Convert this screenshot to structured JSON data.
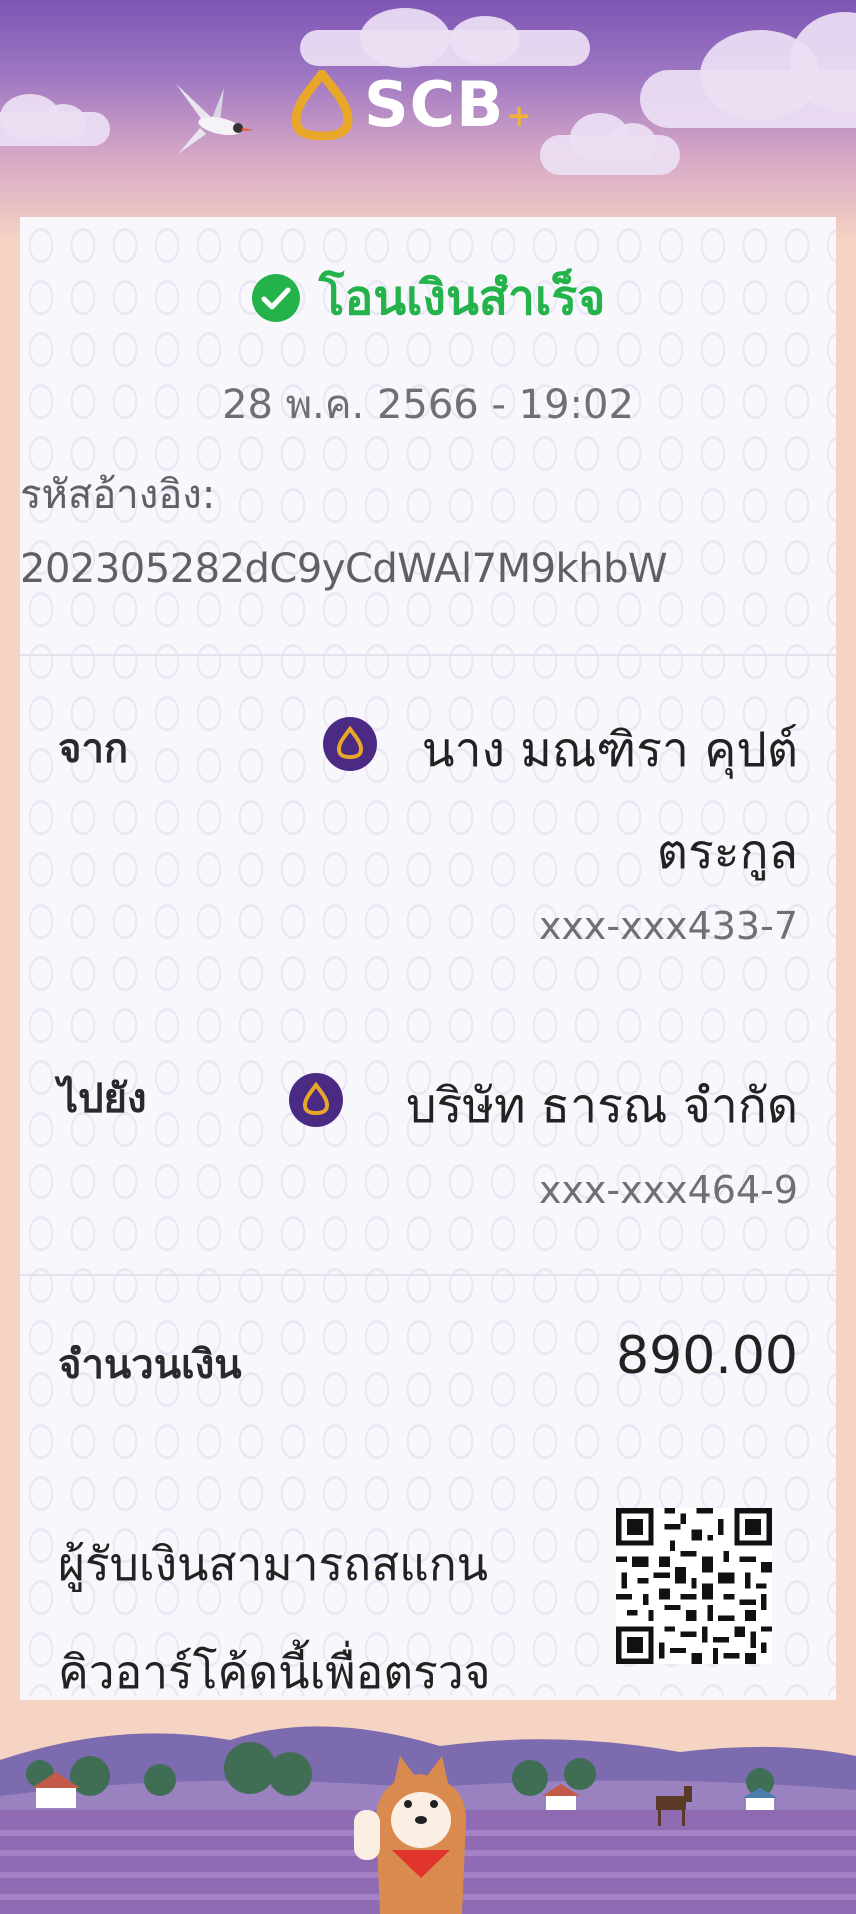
{
  "header": {
    "brand_text": "SCB",
    "brand_plus": "+",
    "accent_color": "#7e55b4",
    "gold_color": "#e9a72a"
  },
  "receipt": {
    "status_text": "โอนเงินสำเร็จ",
    "status_color": "#24b24b",
    "datetime": "28 พ.ค. 2566 - 19:02",
    "ref_label": "รหัสอ้างอิง:",
    "ref_value": "202305282dC9yCdWAl7M9khbW",
    "from": {
      "label": "จาก",
      "name_line1": "นาง มณฑิรา คุปต์",
      "name_line2": "ตระกูล",
      "account": "xxx-xxx433-7",
      "bank_icon": "scb-bank-icon"
    },
    "to": {
      "label": "ไปยัง",
      "name": "บริษัท ธารณ จำกัด",
      "account": "xxx-xxx464-9",
      "bank_icon": "scb-bank-icon"
    },
    "amount_label": "จำนวนเงิน",
    "amount_value": "890.00",
    "scan_note_line1": "ผู้รับเงินสามารถสแกน",
    "scan_note_line2": "คิวอาร์โค้ดนี้เพื่อตรวจ"
  }
}
